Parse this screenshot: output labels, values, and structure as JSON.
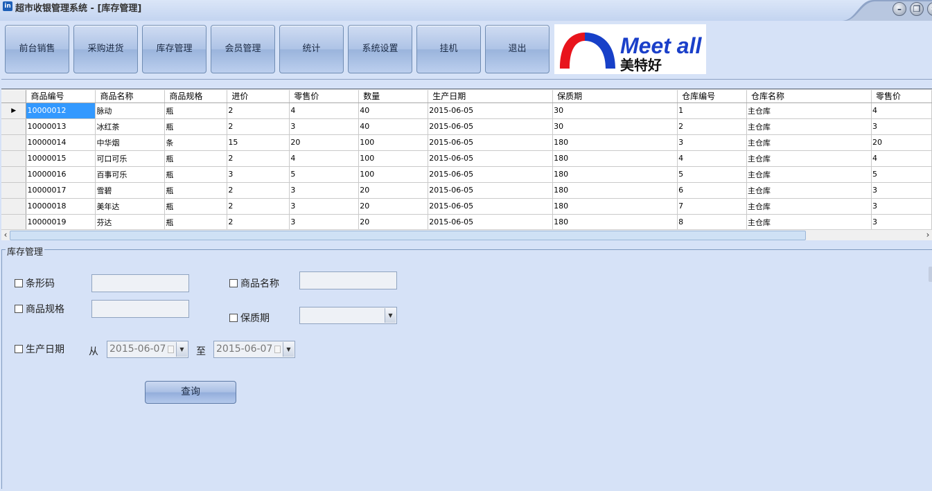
{
  "window": {
    "title": "超市收银管理系统 - [库存管理]",
    "app_icon_text": "in",
    "minimize_glyph": "–",
    "restore_glyph": "❐",
    "close_glyph": "×"
  },
  "toolbar": {
    "buttons": [
      "前台销售",
      "采购进货",
      "库存管理",
      "会员管理",
      "统计",
      "系统设置",
      "挂机",
      "退出"
    ],
    "logo": {
      "text_en": "Meet all",
      "text_cn": "美特好",
      "colors": {
        "arch_left": "#e8141c",
        "arch_right": "#1740c8",
        "text": "#1a3fc9"
      }
    }
  },
  "grid": {
    "columns": [
      "商品编号",
      "商品名称",
      "商品规格",
      "进价",
      "零售价",
      "数量",
      "生产日期",
      "保质期",
      "仓库编号",
      "仓库名称",
      "零售价"
    ],
    "rows": [
      [
        "10000012",
        "脉动",
        "瓶",
        "2",
        "4",
        "40",
        "2015-06-05",
        "30",
        "1",
        "主仓库",
        "4"
      ],
      [
        "10000013",
        "冰红茶",
        "瓶",
        "2",
        "3",
        "40",
        "2015-06-05",
        "30",
        "2",
        "主仓库",
        "3"
      ],
      [
        "10000014",
        "中华烟",
        "条",
        "15",
        "20",
        "100",
        "2015-06-05",
        "180",
        "3",
        "主仓库",
        "20"
      ],
      [
        "10000015",
        "可口可乐",
        "瓶",
        "2",
        "4",
        "100",
        "2015-06-05",
        "180",
        "4",
        "主仓库",
        "4"
      ],
      [
        "10000016",
        "百事可乐",
        "瓶",
        "3",
        "5",
        "100",
        "2015-06-05",
        "180",
        "5",
        "主仓库",
        "5"
      ],
      [
        "10000017",
        "雪碧",
        "瓶",
        "2",
        "3",
        "20",
        "2015-06-05",
        "180",
        "6",
        "主仓库",
        "3"
      ],
      [
        "10000018",
        "美年达",
        "瓶",
        "2",
        "3",
        "20",
        "2015-06-05",
        "180",
        "7",
        "主仓库",
        "3"
      ],
      [
        "10000019",
        "芬达",
        "瓶",
        "2",
        "3",
        "20",
        "2015-06-05",
        "180",
        "8",
        "主仓库",
        "3"
      ]
    ],
    "current_row_marker": "▶",
    "scroll_left": "‹",
    "scroll_right": "›"
  },
  "panel": {
    "legend": "库存管理",
    "barcode_label": "条形码",
    "name_label": "商品名称",
    "spec_label": "商品规格",
    "shelf_life_label": "保质期",
    "prod_date_label": "生产日期",
    "from_label": "从",
    "to_label": "至",
    "date_from": "2015-06-07",
    "date_to": "2015-06-07",
    "dropdown_glyph": "▼",
    "query_button": "查询"
  }
}
